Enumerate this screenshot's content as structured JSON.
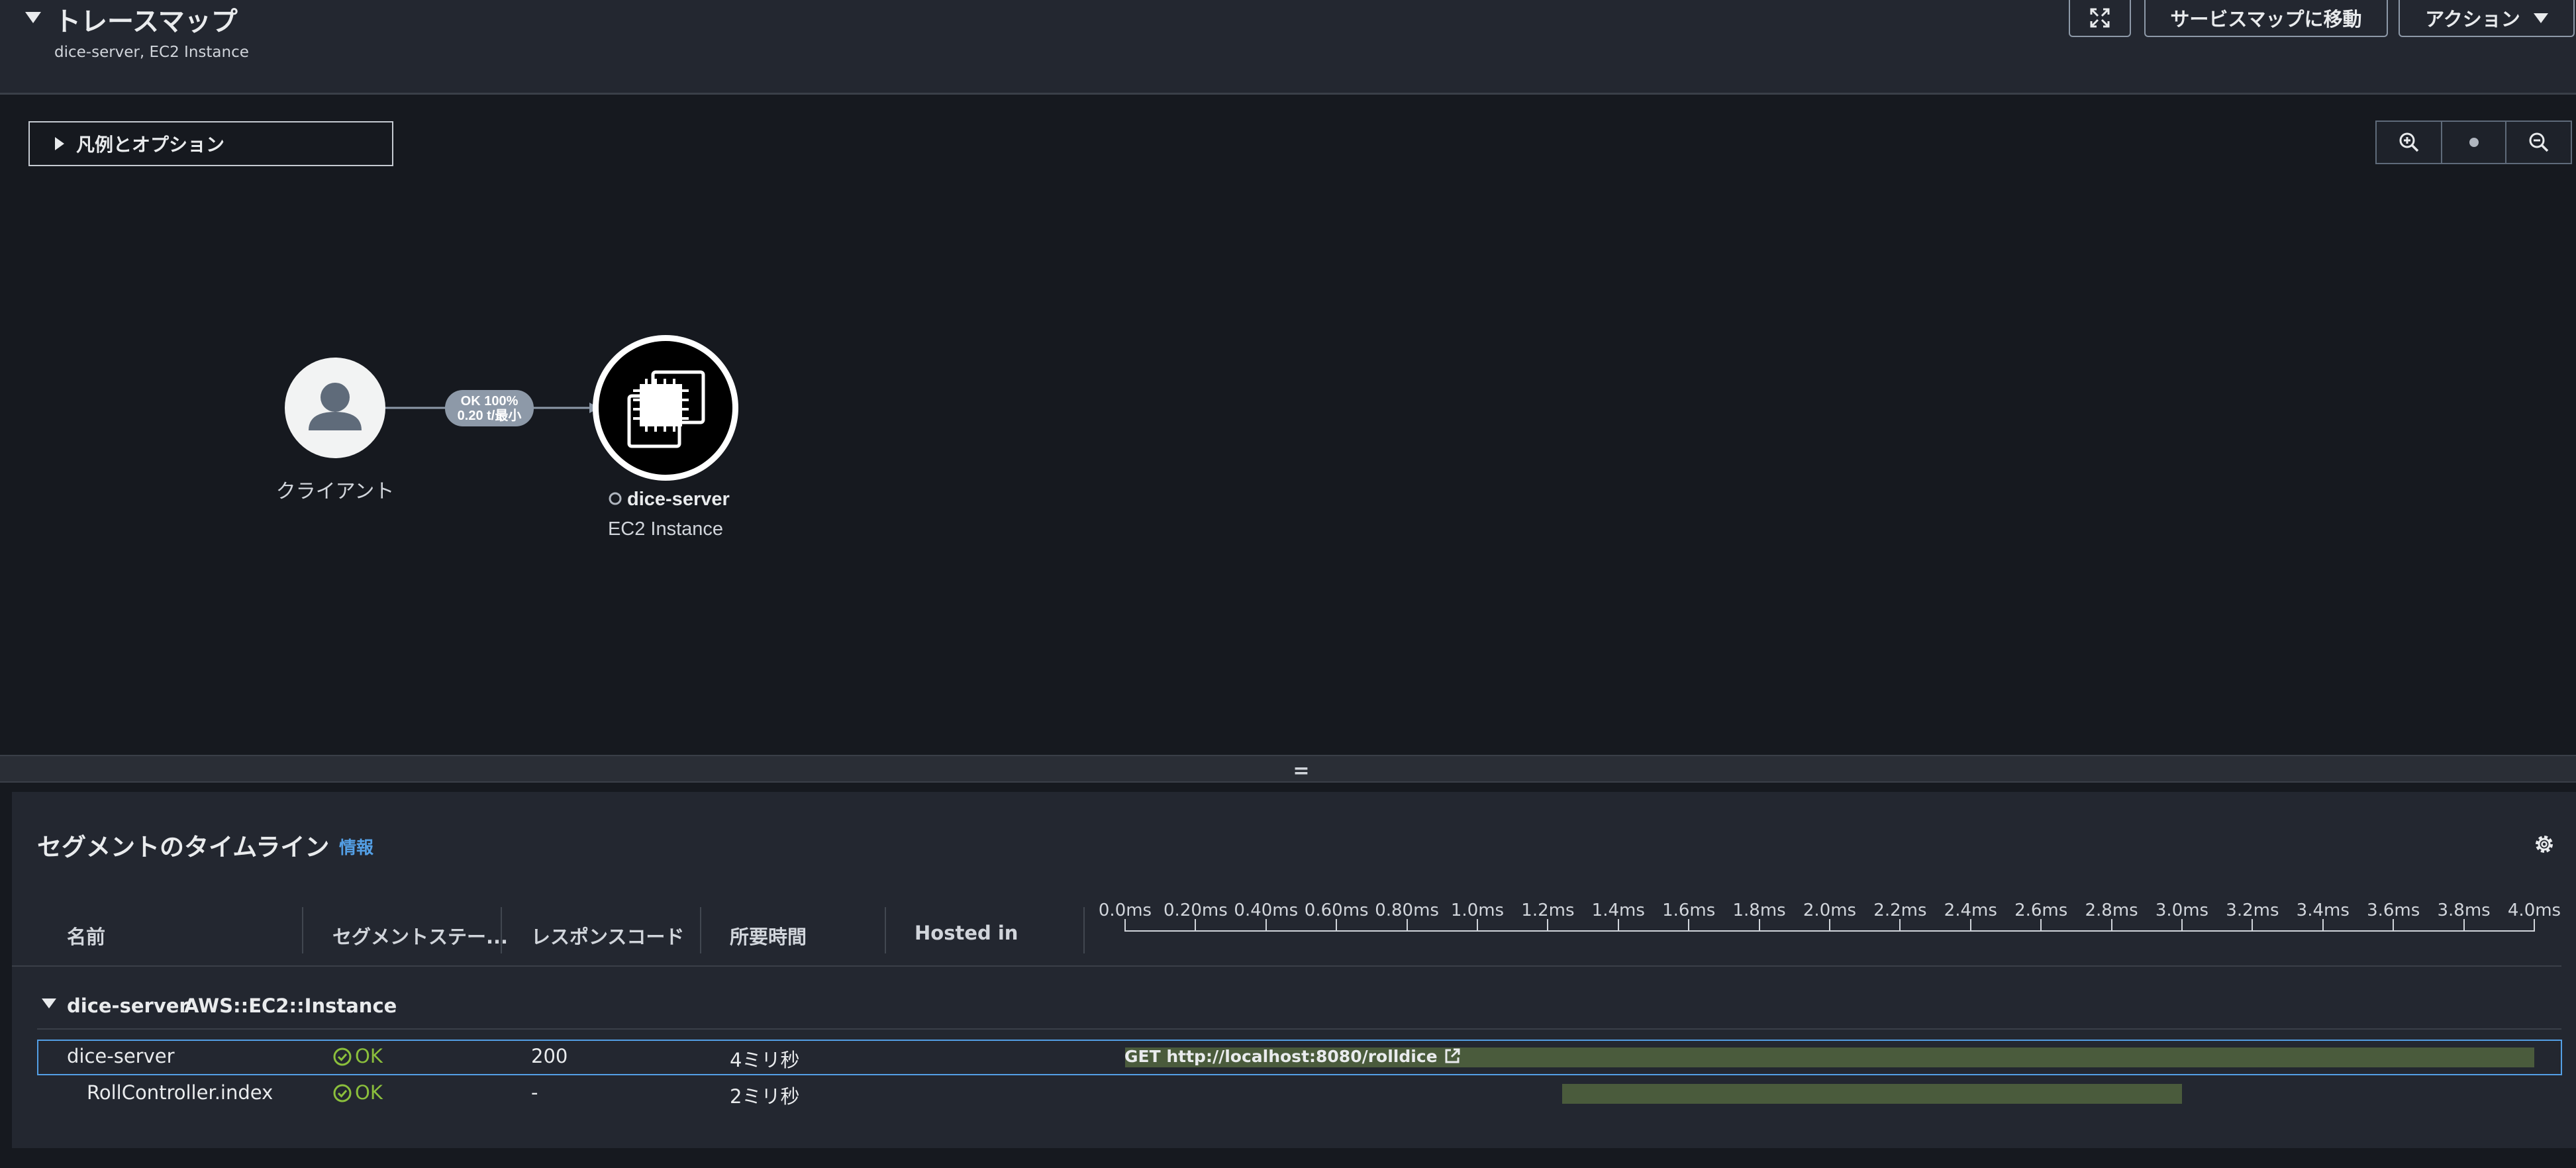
{
  "header": {
    "title": "トレースマップ",
    "subtitle": "dice-server, EC2 Instance",
    "goto_service_map": "サービスマップに移動",
    "actions": "アクション"
  },
  "map": {
    "legend_options": "凡例とオプション",
    "client_label": "クライアント",
    "edge_line1": "OK 100%",
    "edge_line2": "0.20 t/最小",
    "service_name": "dice-server",
    "service_type": "EC2 Instance"
  },
  "timeline": {
    "title": "セグメントのタイムライン",
    "info": "情報",
    "columns": [
      "名前",
      "セグメントステー...",
      "レスポンスコード",
      "所要時間",
      "Hosted in"
    ],
    "ticks": [
      "0.0ms",
      "0.20ms",
      "0.40ms",
      "0.60ms",
      "0.80ms",
      "1.0ms",
      "1.2ms",
      "1.4ms",
      "1.6ms",
      "1.8ms",
      "2.0ms",
      "2.2ms",
      "2.4ms",
      "2.6ms",
      "2.8ms",
      "3.0ms",
      "3.2ms",
      "3.4ms",
      "3.6ms",
      "3.8ms",
      "4.0ms"
    ],
    "group": {
      "name": "dice-server",
      "type": "AWS::EC2::Instance"
    },
    "rows": [
      {
        "name": "dice-server",
        "status": "OK",
        "code": "200",
        "duration": "4ミリ秒",
        "bar_label": "GET http://localhost:8080/rolldice",
        "start_ms": 0.0,
        "end_ms": 4.0
      },
      {
        "name": "RollController.index",
        "status": "OK",
        "code": "-",
        "duration": "2ミリ秒",
        "bar_label": "",
        "start_ms": 1.24,
        "end_ms": 3.0
      }
    ]
  },
  "colors": {
    "bar": "#4a5b3c",
    "ok": "#8bbf3c",
    "link": "#539fe5"
  }
}
